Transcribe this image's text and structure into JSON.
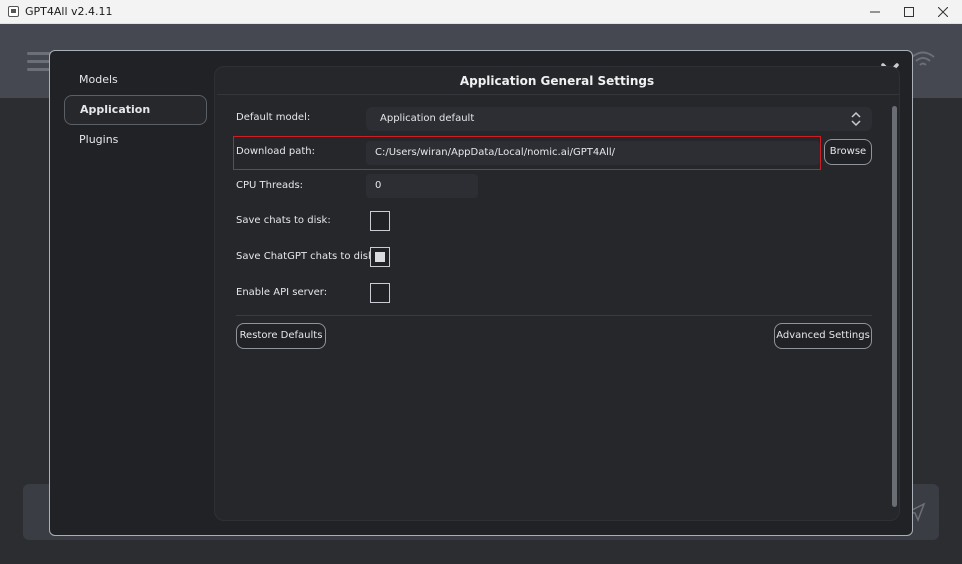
{
  "window": {
    "title": "GPT4All v2.4.11",
    "controls": [
      "minimize-icon",
      "maximize-icon",
      "close-icon"
    ]
  },
  "nav": {
    "items": [
      {
        "label": "Models",
        "active": false
      },
      {
        "label": "Application",
        "active": true
      },
      {
        "label": "Plugins",
        "active": false
      }
    ]
  },
  "panel": {
    "title": "Application General Settings",
    "default_model": {
      "label": "Default model:",
      "value": "Application default"
    },
    "download_path": {
      "label": "Download path:",
      "value": "C:/Users/wiran/AppData/Local/nomic.ai/GPT4All/",
      "browse_label": "Browse"
    },
    "cpu_threads": {
      "label": "CPU Threads:",
      "value": "0"
    },
    "save_chats": {
      "label": "Save chats to disk:",
      "checked": false
    },
    "save_chatgpt_chats": {
      "label": "Save ChatGPT chats to disk:",
      "checked": true
    },
    "api_server": {
      "label": "Enable API server:",
      "checked": false
    },
    "restore_defaults_label": "Restore Defaults",
    "advanced_settings_label": "Advanced Settings"
  },
  "colors": {
    "dialog_bg": "#202225",
    "panel_bg": "#25272b",
    "highlight": "#cc1f25"
  }
}
